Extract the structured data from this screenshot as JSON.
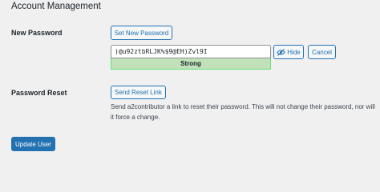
{
  "section": {
    "heading": "Account Management"
  },
  "new_password": {
    "label": "New Password",
    "set_button": "Set New Password",
    "value": ")@u92ztbRLJK%$9@EH)Zvl9I",
    "strength": "Strong",
    "hide_button": "Hide",
    "cancel_button": "Cancel"
  },
  "password_reset": {
    "label": "Password Reset",
    "button": "Send Reset Link",
    "description": "Send a2contributor a link to reset their password. This will not change their password, nor will it force a change."
  },
  "footer": {
    "update_button": "Update User"
  },
  "colors": {
    "accent": "#2271b1",
    "strong_bg": "#c1e1b9",
    "strong_border": "#68de7c",
    "background": "#f0f0f1"
  },
  "icons": {
    "hide": "eye-slash-icon"
  }
}
